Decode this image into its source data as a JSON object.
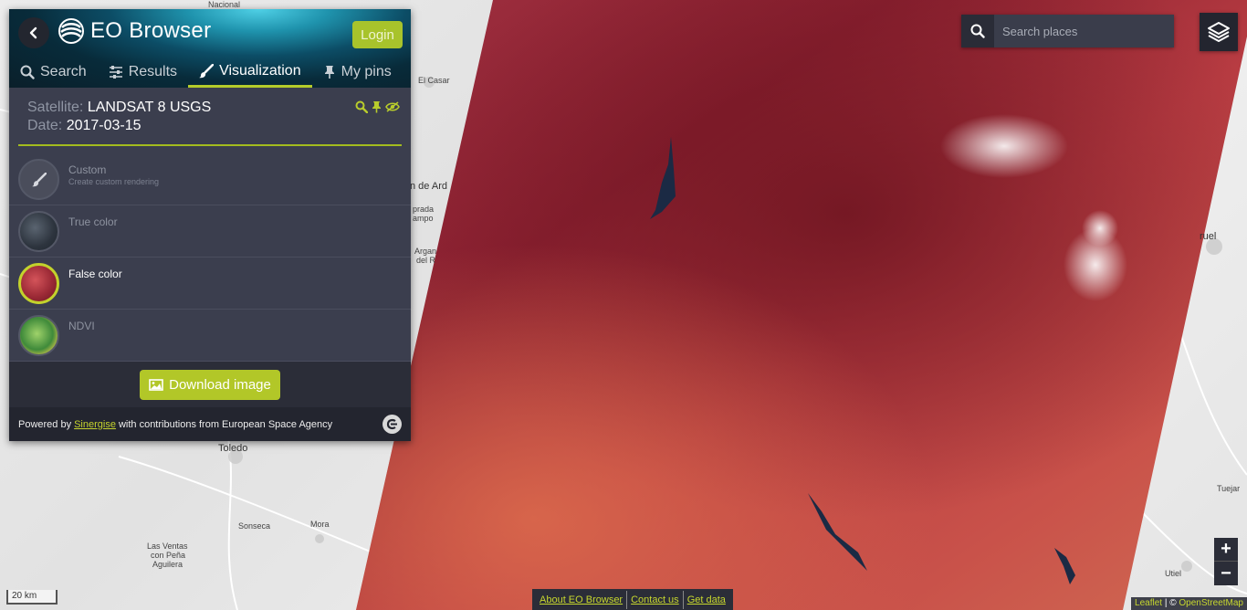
{
  "app": {
    "title": "EO Browser",
    "login_label": "Login",
    "back_icon": "chevron-left-icon",
    "logo_icon": "sinergise-swirl-icon",
    "accent_color": "#b4cc2a"
  },
  "tabs": [
    {
      "label": "Search",
      "icon": "search-icon",
      "active": false
    },
    {
      "label": "Results",
      "icon": "sliders-icon",
      "active": false
    },
    {
      "label": "Visualization",
      "icon": "paintbrush-icon",
      "active": true
    },
    {
      "label": "My pins",
      "icon": "pin-icon",
      "active": false
    }
  ],
  "satellite": {
    "key": "Satellite:",
    "value": "LANDSAT 8 USGS",
    "date_key": "Date:",
    "date_value": "2017-03-15",
    "action_icons": [
      "zoom-icon",
      "pin-icon",
      "hide-icon"
    ]
  },
  "visualizations": [
    {
      "name": "Custom",
      "desc": "Create custom rendering",
      "selected": false
    },
    {
      "name": "True color",
      "desc": "",
      "selected": false
    },
    {
      "name": "False color",
      "desc": "",
      "selected": true
    },
    {
      "name": "NDVI",
      "desc": "",
      "selected": false
    }
  ],
  "download_label": "Download image",
  "footer": {
    "prefix": "Powered by",
    "link": "Sinergise",
    "suffix": "with contributions from European Space Agency"
  },
  "search": {
    "placeholder": "Search places"
  },
  "zoom": {
    "in": "+",
    "out": "−"
  },
  "scale_label": "20 km",
  "bottom_links": [
    "About EO Browser",
    "Contact us",
    "Get data"
  ],
  "attribution": {
    "leaflet": "Leaflet",
    "sep": " | © ",
    "osm": "OpenStreetMap"
  },
  "map_labels": {
    "toledo": "Toledo",
    "sonseca": "Sonseca",
    "mora": "Mora",
    "las_ventas_1": "Las Ventas",
    "las_ventas_2": "con Peña",
    "las_ventas_3": "Aguilera",
    "el_casar": "El Casar",
    "nacional": "Nacional",
    "arde": "n de Ard",
    "prada_1": "prada",
    "prada_2": "ampo",
    "arga_1": "Argan",
    "arga_2": "del R",
    "teruel": "ruel",
    "tuejar": "Tuejar",
    "utiel": "Utiel"
  }
}
